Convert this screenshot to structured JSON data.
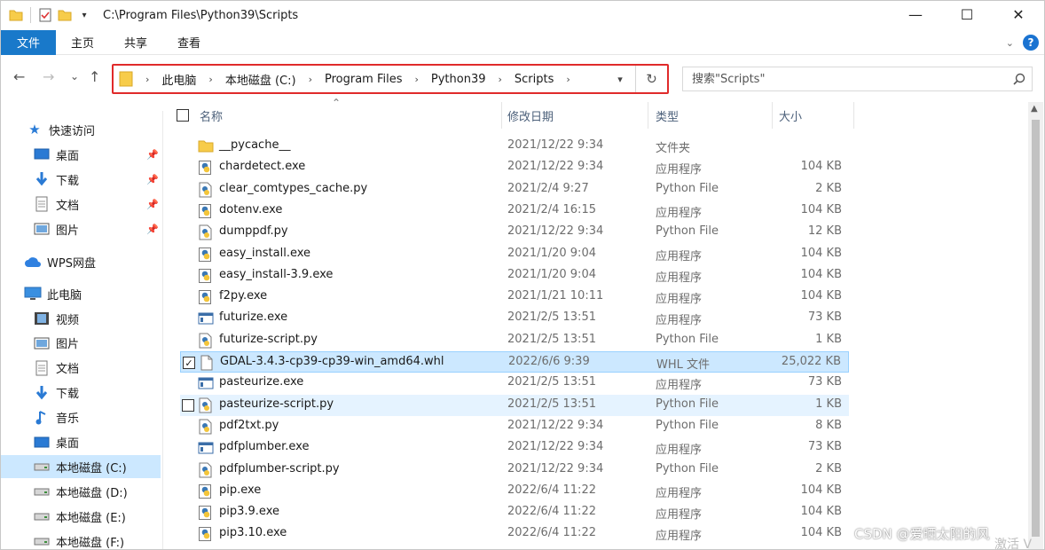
{
  "window": {
    "title_path": "C:\\Program Files\\Python39\\Scripts",
    "minimize": "—",
    "maximize": "☐",
    "close": "✕"
  },
  "ribbon": {
    "tabs": [
      "文件",
      "主页",
      "共享",
      "查看"
    ]
  },
  "nav": {
    "back": "←",
    "forward": "→",
    "recent": "⌄",
    "up": "↑",
    "breadcrumbs": [
      "此电脑",
      "本地磁盘 (C:)",
      "Program Files",
      "Python39",
      "Scripts"
    ],
    "search_placeholder": "搜索\"Scripts\""
  },
  "sidebar": {
    "quick_access": "快速访问",
    "items": [
      {
        "label": "桌面",
        "icon": "desktop-icon"
      },
      {
        "label": "下载",
        "icon": "download-icon"
      },
      {
        "label": "文档",
        "icon": "document-icon"
      },
      {
        "label": "图片",
        "icon": "picture-icon"
      }
    ],
    "wps": "WPS网盘",
    "this_pc": "此电脑",
    "pc_items": [
      {
        "label": "视频",
        "icon": "video-icon"
      },
      {
        "label": "图片",
        "icon": "picture-icon"
      },
      {
        "label": "文档",
        "icon": "document-icon"
      },
      {
        "label": "下载",
        "icon": "download-icon"
      },
      {
        "label": "音乐",
        "icon": "music-icon"
      },
      {
        "label": "桌面",
        "icon": "desktop-icon"
      },
      {
        "label": "本地磁盘 (C:)",
        "icon": "drive-icon"
      },
      {
        "label": "本地磁盘 (D:)",
        "icon": "drive-icon"
      },
      {
        "label": "本地磁盘 (E:)",
        "icon": "drive-icon"
      },
      {
        "label": "本地磁盘 (F:)",
        "icon": "drive-icon"
      }
    ]
  },
  "columns": {
    "name": "名称",
    "date": "修改日期",
    "type": "类型",
    "size": "大小"
  },
  "files": [
    {
      "name": "__pycache__",
      "date": "2021/12/22 9:34",
      "type": "文件夹",
      "size": "",
      "icon": "folder"
    },
    {
      "name": "chardetect.exe",
      "date": "2021/12/22 9:34",
      "type": "应用程序",
      "size": "104 KB",
      "icon": "python-exe"
    },
    {
      "name": "clear_comtypes_cache.py",
      "date": "2021/2/4 9:27",
      "type": "Python File",
      "size": "2 KB",
      "icon": "python-file"
    },
    {
      "name": "dotenv.exe",
      "date": "2021/2/4 16:15",
      "type": "应用程序",
      "size": "104 KB",
      "icon": "python-exe"
    },
    {
      "name": "dumppdf.py",
      "date": "2021/12/22 9:34",
      "type": "Python File",
      "size": "12 KB",
      "icon": "python-file"
    },
    {
      "name": "easy_install.exe",
      "date": "2021/1/20 9:04",
      "type": "应用程序",
      "size": "104 KB",
      "icon": "python-exe"
    },
    {
      "name": "easy_install-3.9.exe",
      "date": "2021/1/20 9:04",
      "type": "应用程序",
      "size": "104 KB",
      "icon": "python-exe"
    },
    {
      "name": "f2py.exe",
      "date": "2021/1/21 10:11",
      "type": "应用程序",
      "size": "104 KB",
      "icon": "python-exe"
    },
    {
      "name": "futurize.exe",
      "date": "2021/2/5 13:51",
      "type": "应用程序",
      "size": "73 KB",
      "icon": "app-exe"
    },
    {
      "name": "futurize-script.py",
      "date": "2021/2/5 13:51",
      "type": "Python File",
      "size": "1 KB",
      "icon": "python-file"
    },
    {
      "name": "GDAL-3.4.3-cp39-cp39-win_amd64.whl",
      "date": "2022/6/6 9:39",
      "type": "WHL 文件",
      "size": "25,022 KB",
      "icon": "blank-file"
    },
    {
      "name": "pasteurize.exe",
      "date": "2021/2/5 13:51",
      "type": "应用程序",
      "size": "73 KB",
      "icon": "app-exe"
    },
    {
      "name": "pasteurize-script.py",
      "date": "2021/2/5 13:51",
      "type": "Python File",
      "size": "1 KB",
      "icon": "python-file"
    },
    {
      "name": "pdf2txt.py",
      "date": "2021/12/22 9:34",
      "type": "Python File",
      "size": "8 KB",
      "icon": "python-file"
    },
    {
      "name": "pdfplumber.exe",
      "date": "2021/12/22 9:34",
      "type": "应用程序",
      "size": "73 KB",
      "icon": "app-exe"
    },
    {
      "name": "pdfplumber-script.py",
      "date": "2021/12/22 9:34",
      "type": "Python File",
      "size": "2 KB",
      "icon": "python-file"
    },
    {
      "name": "pip.exe",
      "date": "2022/6/4 11:22",
      "type": "应用程序",
      "size": "104 KB",
      "icon": "python-exe"
    },
    {
      "name": "pip3.9.exe",
      "date": "2022/6/4 11:22",
      "type": "应用程序",
      "size": "104 KB",
      "icon": "python-exe"
    },
    {
      "name": "pip3.10.exe",
      "date": "2022/6/4 11:22",
      "type": "应用程序",
      "size": "104 KB",
      "icon": "python-exe"
    }
  ],
  "selected_file": "GDAL-3.4.3-cp39-cp39-win_amd64.whl",
  "hovered_file": "pasteurize-script.py",
  "watermark": "CSDN @爱晒太阳的风",
  "activate": "激活 V",
  "colors": {
    "accent": "#1979ca",
    "selection": "#cce8ff",
    "highlight_border": "#e02a2a",
    "folder": "#f7cc4a"
  }
}
